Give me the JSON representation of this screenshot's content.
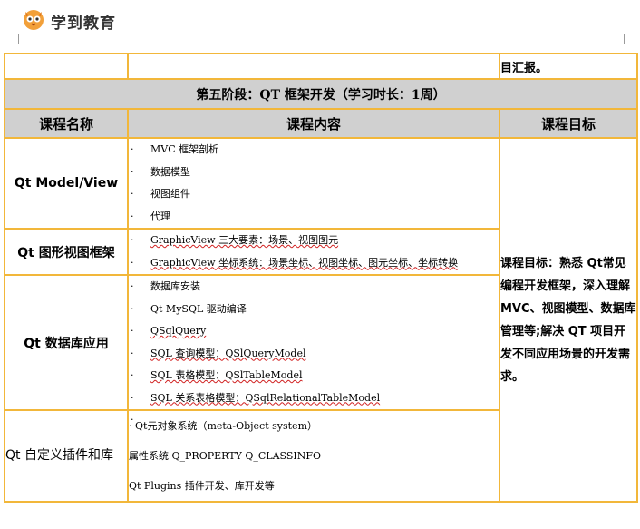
{
  "header": {
    "brand": "学到教育"
  },
  "table": {
    "top_row_goal": "目汇报。",
    "stage_title": "第五阶段：QT 框架开发（学习时长：1周）",
    "headers": {
      "name": "课程名称",
      "content": "课程内容",
      "goal": "课程目标"
    },
    "goal_text": "课程目标：熟悉 Qt常见编程开发框架，深入理解 MVC、视图模型、数据库管理等;解决 QT 项目开发不同应用场景的开发需求。",
    "rows": [
      {
        "name": "Qt Model/View",
        "items": [
          "MVC 框架剖析",
          "数据模型",
          "视图组件",
          "代理"
        ]
      },
      {
        "name": "Qt 图形视图框架",
        "items": [
          "GraphicView 三大要素：场景、视图图元",
          "GraphicView 坐标系统：场景坐标、视图坐标、图元坐标、坐标转换"
        ]
      },
      {
        "name": "Qt 数据库应用",
        "items": [
          "数据库安装",
          "Qt MySQL 驱动编译",
          "QSqlQuery",
          "SQL 查询模型：QSlQueryModel",
          "SQL 表格模型：QSlTableModel",
          "SQL 关系表格模型：QSqlRelationalTableModel",
          ""
        ]
      },
      {
        "name": "Qt 自定义插件和库",
        "items": [
          "Qt元对象系统（meta-Object system）"
        ],
        "lines": [
          "属性系统 Q_PROPERTY Q_CLASSINFO",
          "Qt Plugins 插件开发、库开发等"
        ]
      }
    ]
  },
  "bullet": "·"
}
